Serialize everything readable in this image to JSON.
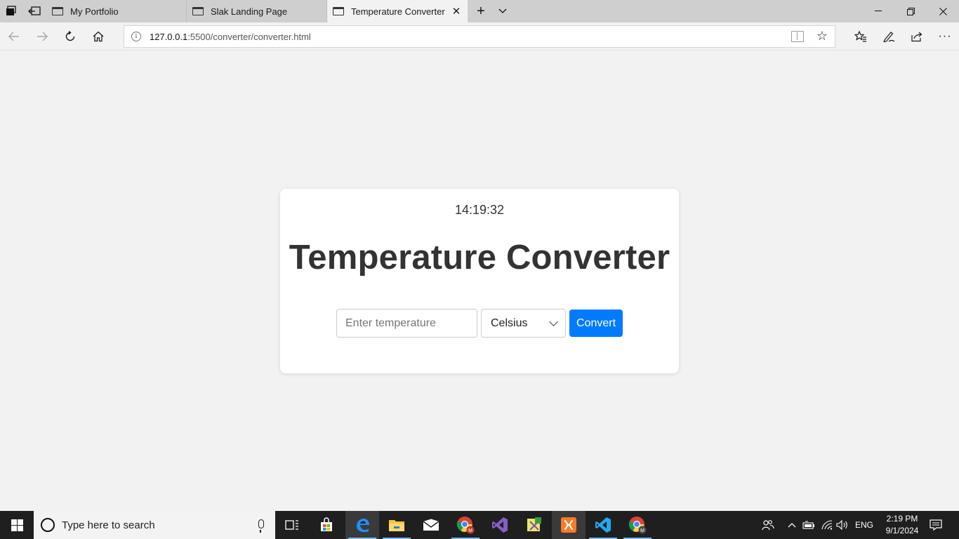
{
  "browser": {
    "tabs": [
      {
        "label": "My Portfolio",
        "active": false
      },
      {
        "label": "Slak Landing Page",
        "active": false
      },
      {
        "label": "Temperature Converter",
        "active": true
      }
    ],
    "address": {
      "host": "127.0.0.1",
      "path": ":5500/converter/converter.html"
    }
  },
  "page": {
    "clock": "14:19:32",
    "title": "Temperature Converter",
    "temperature_input": {
      "value": "",
      "placeholder": "Enter temperature"
    },
    "unit_select": {
      "selected": "Celsius"
    },
    "convert_label": "Convert",
    "accent_color": "#007bff"
  },
  "taskbar": {
    "search_placeholder": "Type here to search",
    "language": "ENG",
    "time": "2:19 PM",
    "date": "9/1/2024",
    "apps": [
      "task-view-icon",
      "store-icon",
      "edge-icon",
      "file-explorer-icon",
      "mail-icon",
      "chrome-icon",
      "visual-studio-icon",
      "app-icon",
      "xampp-icon",
      "vscode-icon",
      "chrome-profile-icon"
    ]
  }
}
